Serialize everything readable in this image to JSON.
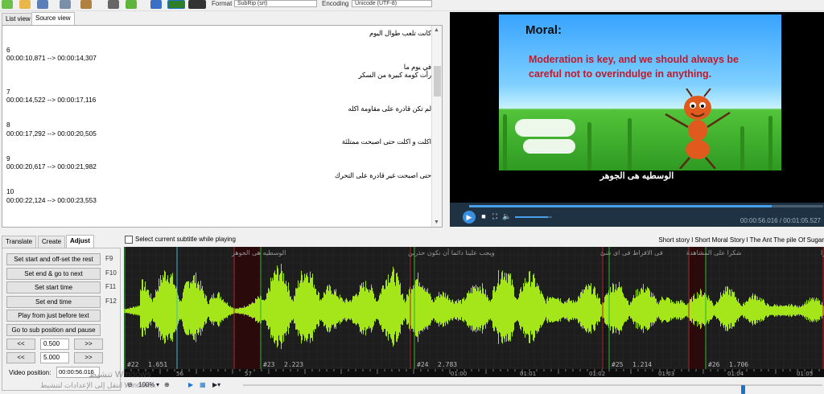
{
  "toolbar": {
    "format_label": "Format",
    "format_value": "SubRip (srt)",
    "encoding_label": "Encoding",
    "encoding_value": "Unicode (UTF-8)"
  },
  "view_tabs": [
    "List view",
    "Source view"
  ],
  "editor": {
    "lines": [
      "كانت تلعب طوال اليوم",
      "",
      "6",
      "00:00:10,871 --> 00:00:14,307",
      "في يوم ما",
      "رأت كومة كبيرة من السكر",
      "",
      "7",
      "00:00:14,522 --> 00:00:17,116",
      "لم تكن قادرة على مقاومة اكله",
      "",
      "8",
      "00:00:17,292 --> 00:00:20,505",
      "اكلت و اكلت حتى اصبحت ممتلئة",
      "",
      "9",
      "00:00:20,617 --> 00:00:21,982",
      "حتى اصبحت غير قادرة على التحرك",
      "",
      "10",
      "00:00:22,124 --> 00:00:23,553"
    ]
  },
  "video": {
    "moral_title": "Moral:",
    "moral_text": "Moderation is key, and we should always be careful not to overindulge in anything.",
    "subtitle": "الوسطيه هى الجوهر",
    "time": "00:00:56.016 / 00:01:05.527",
    "progress": 0.855,
    "volume": 0.9
  },
  "bottom_tabs": [
    "Translate",
    "Create",
    "Adjust"
  ],
  "adjust": {
    "buttons": [
      {
        "label": "Set start and off-set the rest",
        "key": "F9"
      },
      {
        "label": "Set end & go to next",
        "key": "F10"
      },
      {
        "label": "Set start time",
        "key": "F11"
      },
      {
        "label": "Set end time",
        "key": "F12"
      },
      {
        "label": "Play from just before text",
        "key": ""
      },
      {
        "label": "Go to sub position and pause",
        "key": ""
      }
    ],
    "back_label": "<<",
    "forward_label": ">>",
    "step1": "0.500",
    "step2": "5.000",
    "video_position_label": "Video position:",
    "video_position_value": "00:00:56.016"
  },
  "select_current_label": "Select current subtitle while playing",
  "video_title": "Short story l Short Moral Story l The Ant The pile Of Sugar",
  "waveform": {
    "segments": [
      {
        "num": "#22",
        "dur": "1.651",
        "text": "الوسطيه هى الجوهر"
      },
      {
        "num": "#23",
        "dur": "2.223",
        "text": "ويجب علينا دائما أن نكون حذرين"
      },
      {
        "num": "#24",
        "dur": "2.783",
        "text": "فى الافراط فى اى شئ"
      },
      {
        "num": "#25",
        "dur": "1.214",
        "text": "شكرا على المشاهدة"
      },
      {
        "num": "#26",
        "dur": "1.706",
        "text": "ترجمة: جهاد الفرا"
      }
    ],
    "time_labels": [
      "56",
      "57",
      "01:00",
      "01:01",
      "01:02",
      "01:03",
      "01:04",
      "01:05"
    ]
  },
  "wave_controls": {
    "zoom": "100%",
    "zoom_position": 0.86
  },
  "watermark": {
    "line1": "تنشيط Windows",
    "line2": "انتقل إلى الإعدادات لتنشيط Windows."
  },
  "colors": {
    "wave": "#a4e619",
    "selection": "#2a0a0a",
    "video_bg": "#000000",
    "accent": "#1e72c8"
  }
}
